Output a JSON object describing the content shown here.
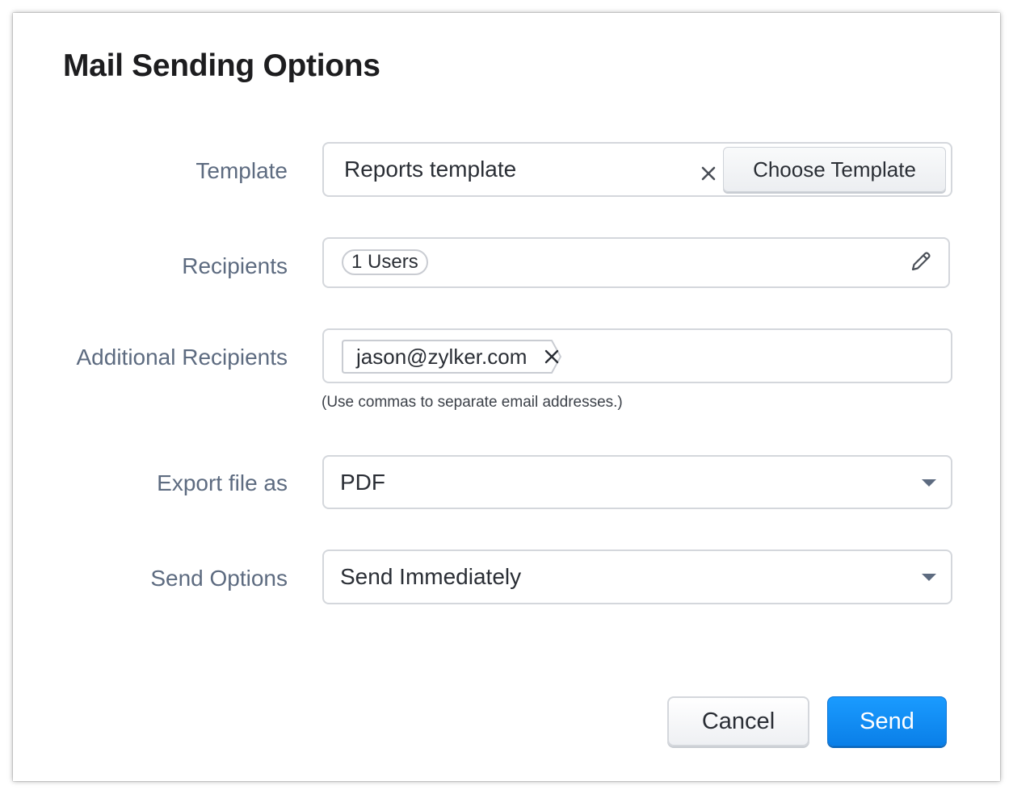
{
  "dialog": {
    "title": "Mail Sending Options"
  },
  "template": {
    "label": "Template",
    "value": "Reports template",
    "clear_icon": "close-icon",
    "choose_label": "Choose Template"
  },
  "recipients": {
    "label": "Recipients",
    "chip": "1 Users",
    "edit_icon": "pencil-icon"
  },
  "additional_recipients": {
    "label": "Additional Recipients",
    "tags": [
      "jason@zylker.com"
    ],
    "remove_icon": "close-icon",
    "hint": "(Use commas to separate email addresses.)"
  },
  "export": {
    "label": "Export file as",
    "selected": "PDF",
    "icon": "caret-down-icon"
  },
  "send_options": {
    "label": "Send Options",
    "selected": "Send Immediately",
    "icon": "caret-down-icon"
  },
  "actions": {
    "cancel_label": "Cancel",
    "send_label": "Send"
  },
  "colors": {
    "primary": "#0a84f5",
    "label": "#5d6b80",
    "border": "#d4d7dc"
  }
}
